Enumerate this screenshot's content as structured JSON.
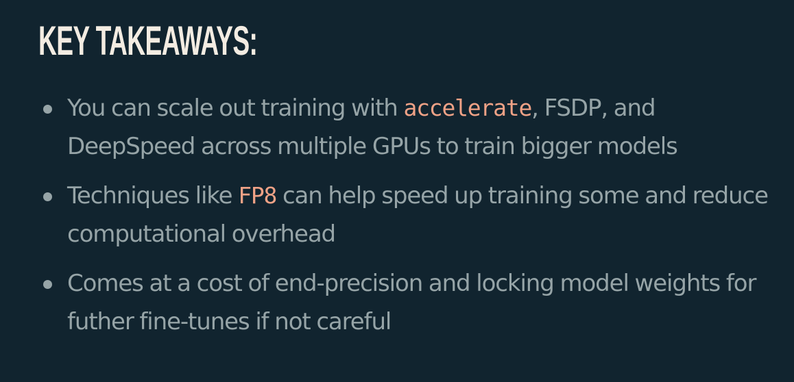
{
  "slide": {
    "title": "KEY TAKEAWAYS:",
    "bullets": [
      {
        "pre": "You can scale out training with ",
        "code": "accelerate",
        "post": ", FSDP, and DeepSpeed across multiple GPUs to train bigger models"
      },
      {
        "pre": "Techniques like ",
        "code": "FP8",
        "post": " can help speed up training some and reduce computational overhead"
      },
      {
        "pre": "Comes at a cost of end-precision and locking model weights for futher fine-tunes if not careful",
        "code": "",
        "post": ""
      }
    ]
  },
  "colors": {
    "background": "#11242f",
    "title": "#f3ece2",
    "body_text": "#96a4a7",
    "code_accent": "#f0a286"
  }
}
